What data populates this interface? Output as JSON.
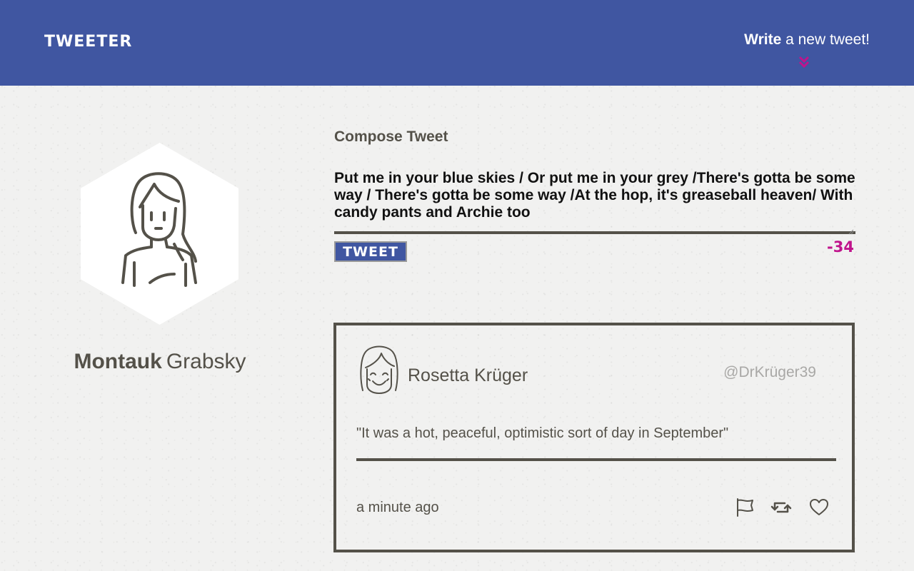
{
  "header": {
    "brand": "TWEETER",
    "write_bold": "Write",
    "write_rest": " a new tweet!",
    "accent_color": "#c0148c",
    "background_color": "#4056a1",
    "toggle_icon": "double-chevron-down-icon"
  },
  "profile": {
    "first_name": "Montauk",
    "last_name": "Grabsky",
    "avatar_icon": "woman-avatar-icon"
  },
  "compose": {
    "title": "Compose Tweet",
    "text": "Put me in your blue skies / Or put me in your grey /There's gotta be some way / There's gotta be some way /At the hop, it's greaseball heaven/ With candy pants and Archie too",
    "button_label": "TWEET",
    "counter": "-34",
    "counter_color": "#c0148c"
  },
  "tweets": [
    {
      "name": "Rosetta Krüger",
      "handle": "@DrKrüger39",
      "content": "\"It was a hot, peaceful, optimistic sort of day in September\"",
      "time": "a minute ago",
      "avatar_icon": "smiling-girl-avatar-icon",
      "actions": [
        "flag-icon",
        "retweet-icon",
        "heart-icon"
      ]
    }
  ]
}
